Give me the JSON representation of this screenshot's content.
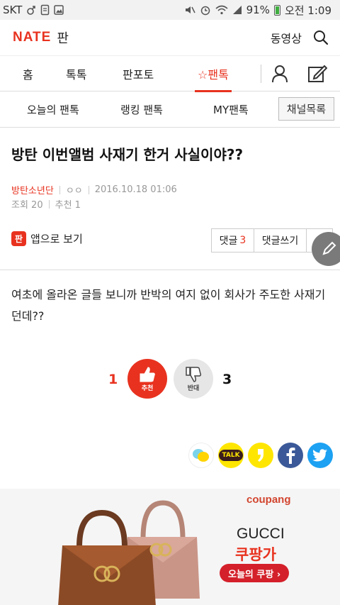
{
  "status_bar": {
    "carrier": "SKT",
    "battery": "91%",
    "time": "오전 1:09"
  },
  "header": {
    "logo_nate": "NATE",
    "logo_pan": "판",
    "video": "동영상"
  },
  "tabs": [
    {
      "label": "홈"
    },
    {
      "label": "톡톡"
    },
    {
      "label": "판포토"
    },
    {
      "label": "☆팬톡"
    }
  ],
  "subtabs": {
    "items": [
      {
        "label": "오늘의 팬톡"
      },
      {
        "label": "랭킹 팬톡"
      },
      {
        "label": "MY팬톡"
      }
    ],
    "channel_list": "채널목록"
  },
  "article": {
    "title": "방탄 이번앨범 사재기 한거 사실이야??",
    "author": "방탄소년단",
    "author_extra": "ㅇㅇ",
    "date": "2016.10.18 01:06",
    "views": "조회 20",
    "recommend": "추천 1",
    "app_view": "앱으로 보기",
    "app_badge": "판",
    "comment_label": "댓글",
    "comment_count": "3",
    "write_comment": "댓글쓰기",
    "more": "···",
    "body": "여초에 올라온 글들 보니까 반박의 여지 없이 회사가 주도한 사재기 던데??"
  },
  "vote": {
    "up_count": "1",
    "up_label": "추천",
    "down_label": "반대",
    "down_count": "3"
  },
  "share": {
    "kakao_talk": "TALK"
  },
  "ad": {
    "brand": "coupang",
    "product": "GUCCI",
    "store": "쿠팡가",
    "cta": "오늘의 쿠팡 ›"
  },
  "colors": {
    "accent": "#e8321f",
    "facebook": "#3b5998",
    "twitter": "#1da1f2",
    "kakao": "#ffe600"
  }
}
